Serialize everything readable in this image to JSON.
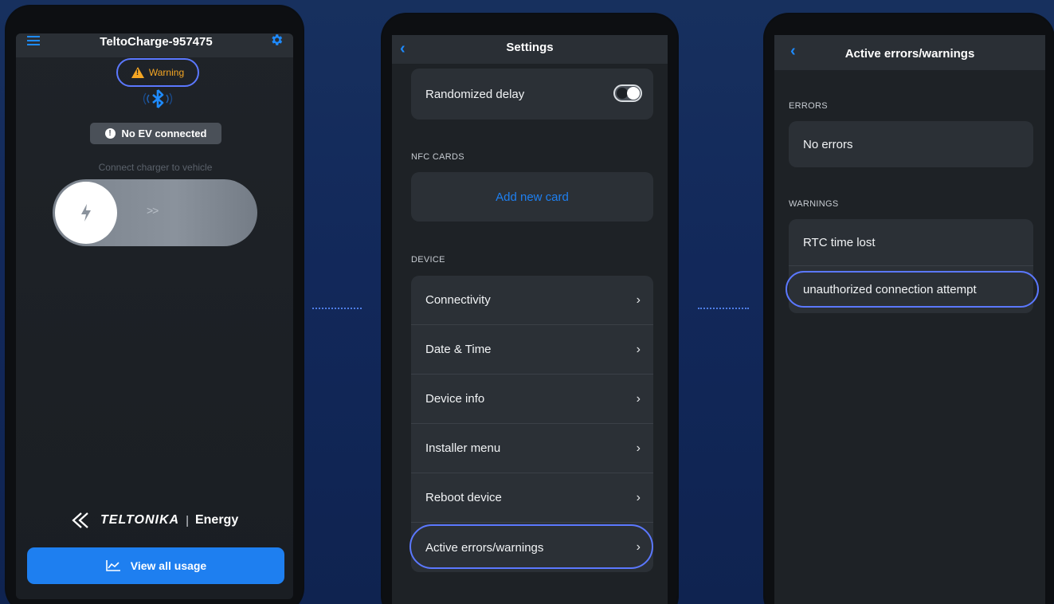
{
  "phone1": {
    "device_name": "TeltoCharge-957475",
    "warning_label": "Warning",
    "ev_status": "No EV connected",
    "hint": "Connect charger to vehicle",
    "slider_arrows": ">>",
    "brand_logo": "TELTONIKA",
    "brand_sep": "|",
    "brand_suffix": "Energy",
    "usage_button": "View all usage",
    "accent_color": "#1e7ff0",
    "warning_color": "#f5a623"
  },
  "phone2": {
    "title": "Settings",
    "randomized_delay": "Randomized delay",
    "nfc_section": "NFC CARDS",
    "add_card": "Add new card",
    "device_section": "DEVICE",
    "device_items": [
      "Connectivity",
      "Date & Time",
      "Device info",
      "Installer menu",
      "Reboot device",
      "Active errors/warnings"
    ]
  },
  "phone3": {
    "title": "Active errors/warnings",
    "errors_section": "ERRORS",
    "errors_items": [
      "No errors"
    ],
    "warnings_section": "WARNINGS",
    "warnings_items": [
      "RTC time lost",
      "unauthorized connection attempt"
    ]
  }
}
